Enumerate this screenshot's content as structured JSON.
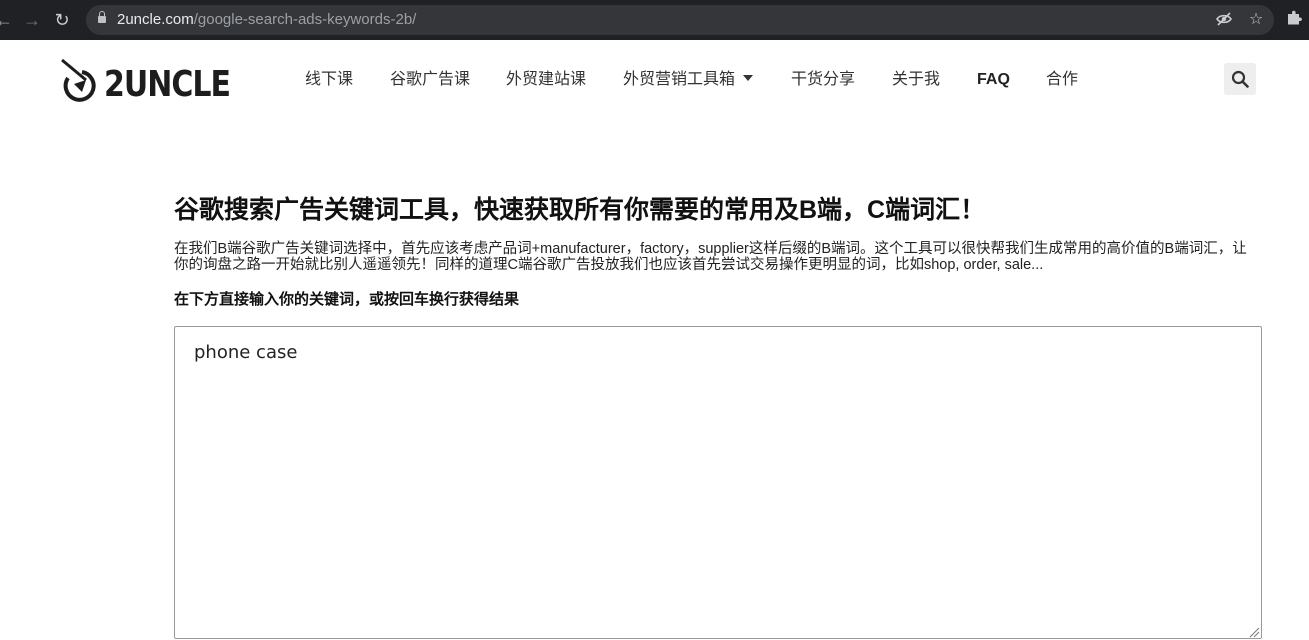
{
  "browser": {
    "url_host": "2uncle.com",
    "url_path": "/google-search-ads-keywords-2b/",
    "icons": [
      "back-arrow-icon",
      "forward-arrow-icon",
      "reload-icon",
      "lock-icon",
      "eye-off-icon",
      "star-icon",
      "puzzle-icon"
    ]
  },
  "site": {
    "logo_text": "2UNCLE"
  },
  "nav": {
    "items": [
      {
        "label": "线下课"
      },
      {
        "label": "谷歌广告课"
      },
      {
        "label": "外贸建站课"
      },
      {
        "label": "外贸营销工具箱"
      },
      {
        "label": "干货分享"
      },
      {
        "label": "关于我"
      },
      {
        "label": "FAQ"
      },
      {
        "label": "合作"
      }
    ]
  },
  "content": {
    "title": "谷歌搜索广告关键词工具，快速获取所有你需要的常用及B端，C端词汇！",
    "intro": "在我们B端谷歌广告关键词选择中，首先应该考虑产品词+manufacturer，factory，supplier这样后缀的B端词。这个工具可以很快帮我们生成常用的高价值的B端词汇，让你的询盘之路一开始就比别人遥遥领先！同样的道理C端谷歌广告投放我们也应该首先尝试交易操作更明显的词，比如shop, order, sale...",
    "instruction": "在下方直接输入你的关键词，或按回车换行获得结果",
    "keyword_value": "phone case"
  },
  "colors": {
    "chrome_bg": "#202124",
    "omnibox_bg": "#35363a",
    "text_dark": "#111111",
    "search_btn_bg": "#eeeeee"
  }
}
